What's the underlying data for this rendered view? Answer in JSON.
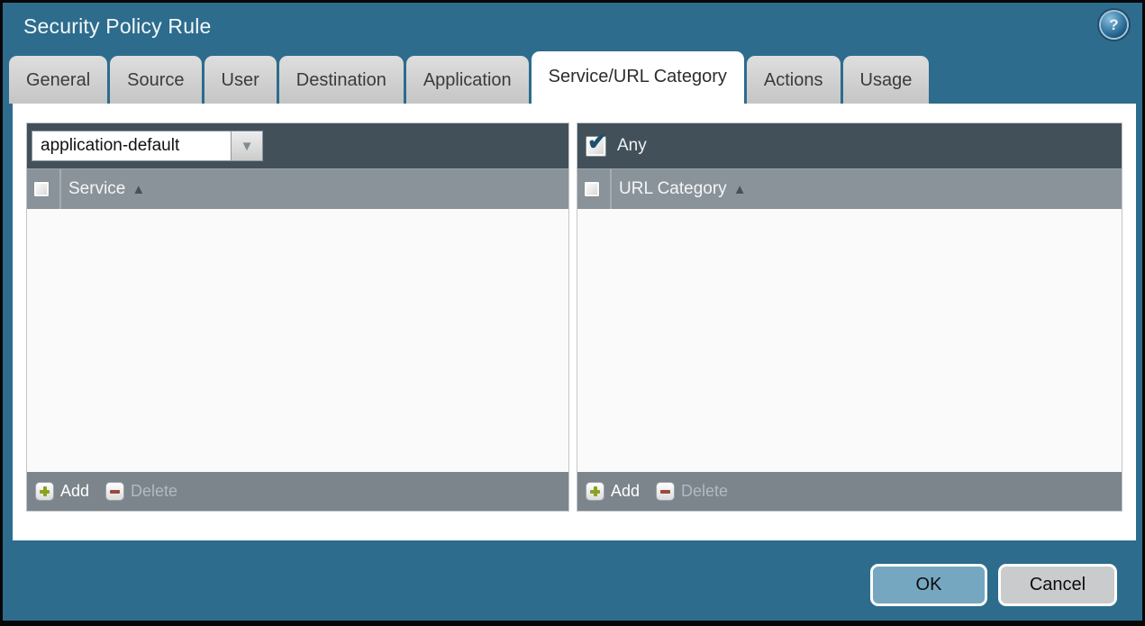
{
  "window": {
    "title": "Security Policy Rule",
    "help_icon_glyph": "?"
  },
  "tabs": [
    {
      "label": "General",
      "active": false
    },
    {
      "label": "Source",
      "active": false
    },
    {
      "label": "User",
      "active": false
    },
    {
      "label": "Destination",
      "active": false
    },
    {
      "label": "Application",
      "active": false
    },
    {
      "label": "Service/URL Category",
      "active": true
    },
    {
      "label": "Actions",
      "active": false
    },
    {
      "label": "Usage",
      "active": false
    }
  ],
  "service_panel": {
    "dropdown": {
      "value": "application-default",
      "arrow_glyph": "▼"
    },
    "column_header": {
      "label": "Service",
      "sort": "ascending",
      "sort_glyph": "▲",
      "checkbox_checked": false
    },
    "rows": [],
    "toolbar": {
      "add_label": "Add",
      "delete_label": "Delete",
      "delete_enabled": false
    }
  },
  "url_category_panel": {
    "any_checkbox": {
      "label": "Any",
      "checked": true,
      "check_glyph": "✔"
    },
    "column_header": {
      "label": "URL Category",
      "sort": "ascending",
      "sort_glyph": "▲",
      "checkbox_checked": false
    },
    "rows": [],
    "toolbar": {
      "add_label": "Add",
      "delete_label": "Delete",
      "delete_enabled": false
    }
  },
  "footer": {
    "ok_label": "OK",
    "cancel_label": "Cancel"
  },
  "colors": {
    "background_teal": "#2D6C8D",
    "panel_header_dark": "#42505A",
    "column_header_gray": "#8B939A",
    "toolbar_gray": "#7C858C",
    "list_background": "#FAFAFA",
    "tab_inactive": "#CFCFCF",
    "tab_active": "#FFFFFF",
    "add_plus_green": "#8AA31F",
    "delete_minus_red": "#9B4A40",
    "checkmark_blue": "#1D4F6E",
    "ok_button_fill": "#76A7C0",
    "cancel_button_fill": "#C9CBCC"
  }
}
